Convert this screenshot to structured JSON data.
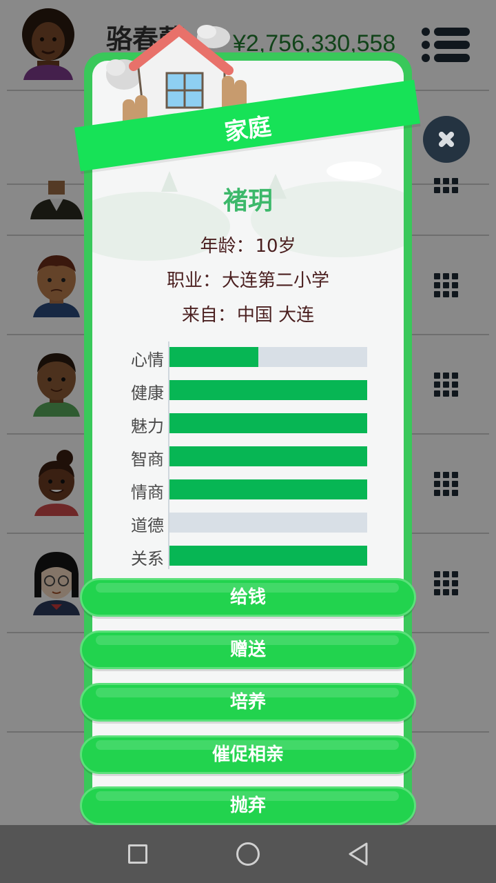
{
  "header": {
    "player_name": "骆春蕾",
    "money": "¥2,756,330,558",
    "menu_icon": "menu-icon"
  },
  "dialog": {
    "title": "家庭",
    "name": "褚玥",
    "age_label": "年龄：",
    "age_value": "10岁",
    "job_label": "职业：",
    "job_value": "大连第二小学",
    "from_label": "来自：",
    "from_value": "中国 大连",
    "stats": [
      {
        "label": "心情",
        "value": 0.45
      },
      {
        "label": "健康",
        "value": 1.0
      },
      {
        "label": "魅力",
        "value": 1.0
      },
      {
        "label": "智商",
        "value": 1.0
      },
      {
        "label": "情商",
        "value": 1.0
      },
      {
        "label": "道德",
        "value": 0.0
      },
      {
        "label": "关系",
        "value": 1.0
      }
    ],
    "actions": [
      "给钱",
      "赠送",
      "培养",
      "催促相亲",
      "抛弃"
    ]
  },
  "colors": {
    "accent_green": "#17e257",
    "bar_fill": "#07b654",
    "bar_track": "#d8dfe6",
    "money_green": "#1f7a2e"
  }
}
